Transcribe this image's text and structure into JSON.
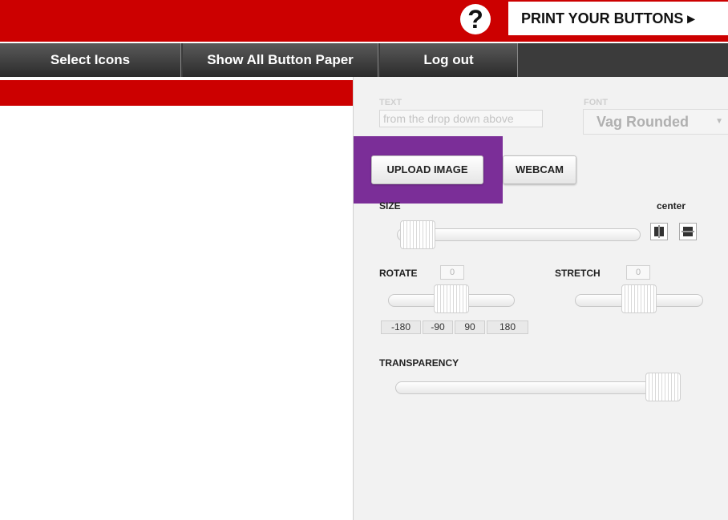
{
  "header": {
    "help_label": "?",
    "print_label": "PRINT YOUR BUTTONS ▸"
  },
  "nav": {
    "items": [
      {
        "label": "Select Icons"
      },
      {
        "label": "Show All Button Paper"
      },
      {
        "label": "Log out"
      }
    ]
  },
  "panel": {
    "text_label": "TEXT",
    "text_placeholder": "from the drop down above",
    "font_label": "FONT",
    "font_value": "Vag Rounded",
    "upload_label": "UPLOAD IMAGE",
    "webcam_label": "WEBCAM",
    "size_label": "SIZE",
    "center_label": "center",
    "rotate_label": "ROTATE",
    "rotate_value": "0",
    "stretch_label": "STRETCH",
    "stretch_value": "0",
    "rotate_presets": [
      "-180",
      "-90",
      "90",
      "180"
    ],
    "transparency_label": "TRANSPARENCY"
  },
  "colors": {
    "brand_red": "#cc0000",
    "nav_dark": "#3b3b3b",
    "highlight_purple": "#7b2e98",
    "panel_bg": "#f2f2f2"
  }
}
